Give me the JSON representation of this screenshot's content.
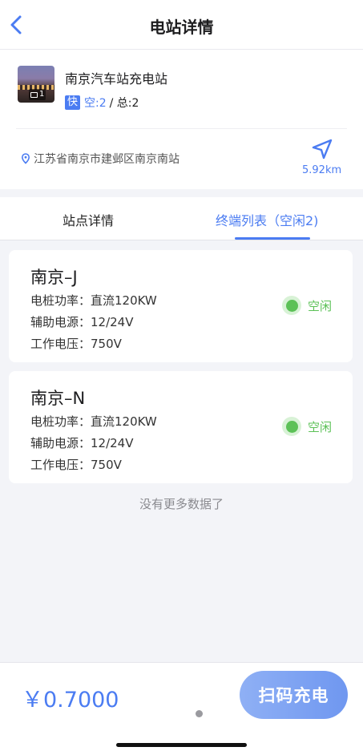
{
  "nav": {
    "title": "电站详情"
  },
  "station": {
    "name": "南京汽车站充电站",
    "photo_count": "1",
    "fast_tag": "快",
    "free_text": "空:2",
    "total_text": "/ 总:2",
    "address": "江苏省南京市建邺区南京南站",
    "distance": "5.92km"
  },
  "tabs": [
    {
      "label": "站点详情"
    },
    {
      "label": "终端列表（空闲2)"
    }
  ],
  "terminals": [
    {
      "name": "南京–J",
      "power": "电桩功率：直流120KW",
      "aux": "辅助电源：12/24V",
      "voltage": "工作电压：750V",
      "status": "空闲"
    },
    {
      "name": "南京–N",
      "power": "电桩功率：直流120KW",
      "aux": "辅助电源：12/24V",
      "voltage": "工作电压：750V",
      "status": "空闲"
    }
  ],
  "list_end_text": "没有更多数据了",
  "footer": {
    "price": "￥0.7000",
    "scan_button": "扫码充电"
  },
  "colors": {
    "accent": "#4b7cf2",
    "status_green": "#5cc157"
  }
}
